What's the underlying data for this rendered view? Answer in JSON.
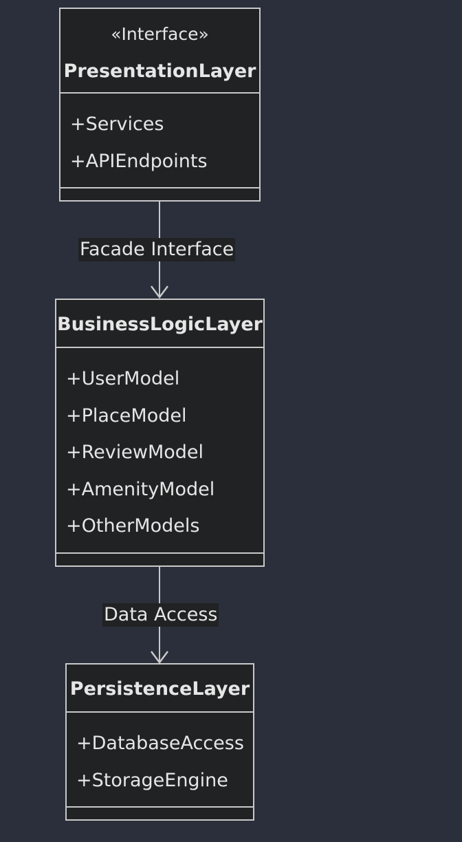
{
  "classes": {
    "presentation": {
      "stereotype": "«Interface»",
      "name": "PresentationLayer",
      "attributes": [
        "+Services",
        "+APIEndpoints"
      ]
    },
    "business": {
      "name": "BusinessLogicLayer",
      "attributes": [
        "+UserModel",
        "+PlaceModel",
        "+ReviewModel",
        "+AmenityModel",
        "+OtherModels"
      ]
    },
    "persistence": {
      "name": "PersistenceLayer",
      "attributes": [
        "+DatabaseAccess",
        "+StorageEngine"
      ]
    }
  },
  "edges": {
    "facade": {
      "label": "Facade Interface"
    },
    "data_access": {
      "label": "Data Access"
    }
  },
  "colors": {
    "background": "#2a2f3b",
    "box_fill": "#212223",
    "stroke": "#c9c9c9",
    "text": "#e6e6e6"
  }
}
